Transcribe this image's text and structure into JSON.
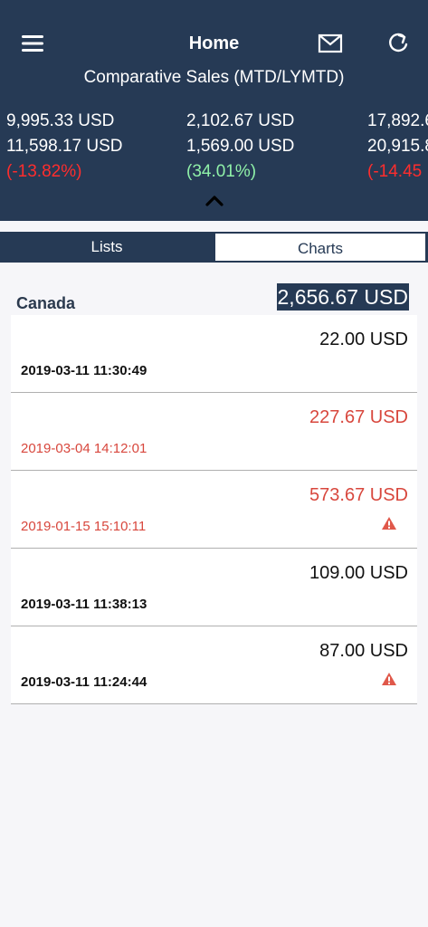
{
  "header": {
    "title": "Home",
    "subtitle": "Comparative Sales (MTD/LYMTD)",
    "icons": {
      "menu": "menu-icon",
      "mail": "mail-icon",
      "refresh": "refresh-icon",
      "collapse": "chevron-up-icon"
    },
    "metrics": [
      {
        "current": "9,995.33 USD",
        "previous": "11,598.17 USD",
        "change": "(-13.82%)",
        "trend": "negative"
      },
      {
        "current": "2,102.67 USD",
        "previous": "1,569.00 USD",
        "change": "(34.01%)",
        "trend": "positive"
      },
      {
        "current": "17,892.6",
        "previous": "20,915.8",
        "change": "(-14.45",
        "trend": "negative"
      }
    ]
  },
  "tabs": [
    {
      "label": "Lists",
      "active": true
    },
    {
      "label": "Charts",
      "active": false
    }
  ],
  "region": {
    "name": "Canada",
    "total": "2,656.67 USD"
  },
  "transactions": [
    {
      "amount": "22.00 USD",
      "datetime": "2019-03-11 11:30:49",
      "alert": false,
      "warning": false
    },
    {
      "amount": "227.67 USD",
      "datetime": "2019-03-04 14:12:01",
      "alert": true,
      "warning": false
    },
    {
      "amount": "573.67 USD",
      "datetime": "2019-01-15 15:10:11",
      "alert": true,
      "warning": true
    },
    {
      "amount": "109.00 USD",
      "datetime": "2019-03-11 11:38:13",
      "alert": false,
      "warning": false
    },
    {
      "amount": "87.00 USD",
      "datetime": "2019-03-11 11:24:44",
      "alert": false,
      "warning": true
    }
  ],
  "colors": {
    "header_bg": "#263a55",
    "negative": "#ff2d2d",
    "positive": "#8ff0a8",
    "alert_text": "#d8473d",
    "warning_icon": "#e0584a"
  }
}
